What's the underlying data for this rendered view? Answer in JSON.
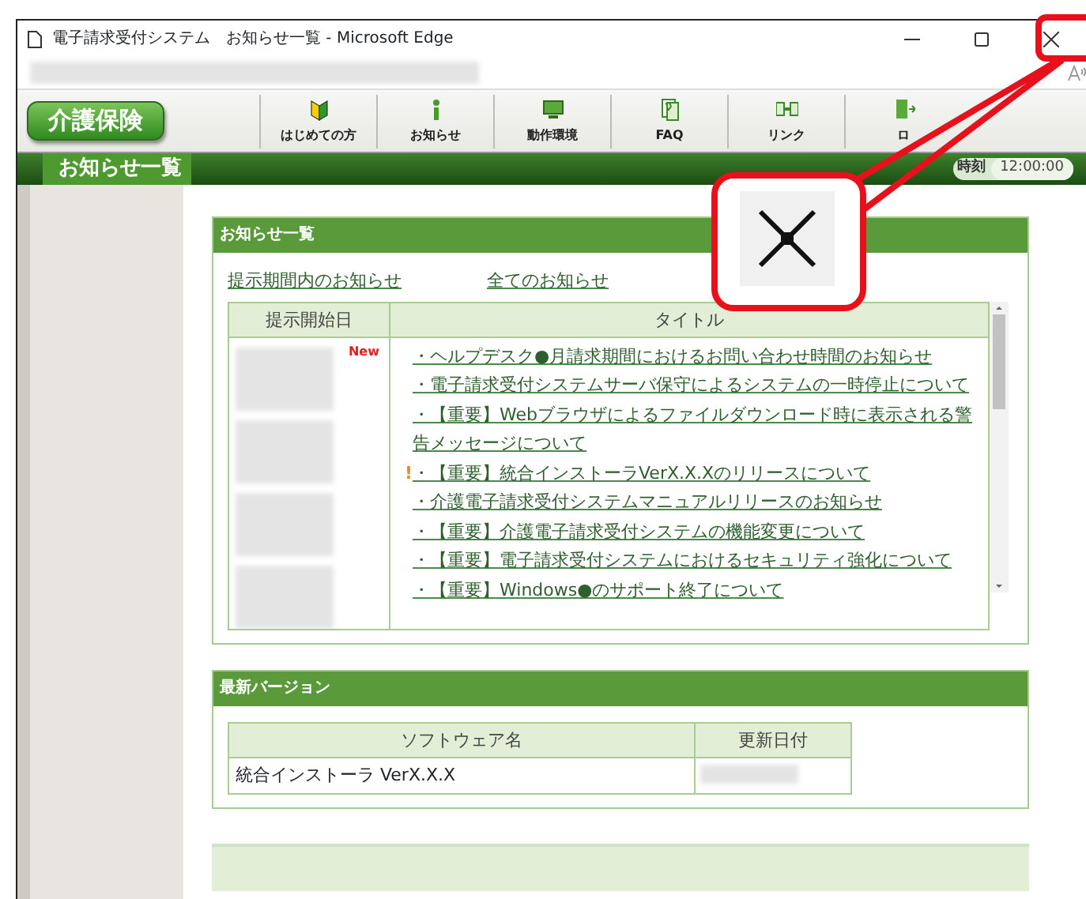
{
  "window": {
    "title": "電子請求受付システム　お知らせ一覧 - Microsoft Edge"
  },
  "toolbar": {
    "logo": "介護保険",
    "items": [
      {
        "label": "はじめての方"
      },
      {
        "label": "お知らせ"
      },
      {
        "label": "動作環境"
      },
      {
        "label": "FAQ"
      },
      {
        "label": "リンク"
      },
      {
        "label": "ロ"
      }
    ]
  },
  "page_bar": {
    "title": "お知らせ一覧",
    "clock_label": "時刻",
    "clock": "12:00:00"
  },
  "notices": {
    "title": "お知らせ一覧",
    "filters": [
      "提示期間内のお知らせ",
      "全てのお知らせ"
    ],
    "columns": [
      "提示開始日",
      "タイトル"
    ],
    "badge": "New",
    "rows": [
      {
        "marker": "",
        "title": "・ヘルプデスク●月請求期間におけるお問い合わせ時間のお知らせ"
      },
      {
        "marker": "",
        "title": "・電子請求受付システムサーバ保守によるシステムの一時停止について"
      },
      {
        "marker": "",
        "title": "・【重要】Webブラウザによるファイルダウンロード時に表示される警告メッセージについて"
      },
      {
        "marker": "!",
        "title": "・【重要】統合インストーラVerX.X.Xのリリースについて"
      },
      {
        "marker": "",
        "title": "・介護電子請求受付システムマニュアルリリースのお知らせ"
      },
      {
        "marker": "",
        "title": "・【重要】介護電子請求受付システムの機能変更について"
      },
      {
        "marker": "",
        "title": "・【重要】電子請求受付システムにおけるセキュリティ強化について"
      },
      {
        "marker": "",
        "title": "・【重要】Windows●のサポート終了について"
      }
    ]
  },
  "version": {
    "title": "最新バージョン",
    "columns": [
      "ソフトウェア名",
      "更新日付"
    ],
    "rows": [
      {
        "name": "統合インストーラ VerX.X.X"
      }
    ]
  }
}
